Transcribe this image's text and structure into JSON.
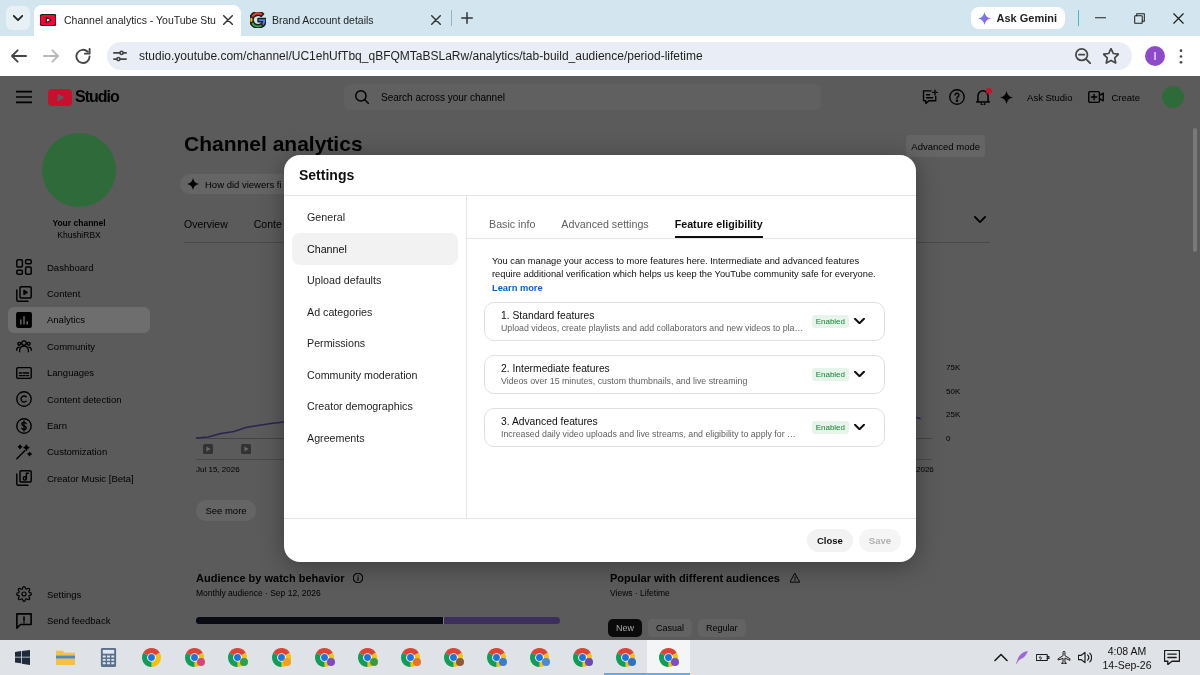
{
  "browser": {
    "tabs": [
      {
        "kind": "youtube",
        "title": "Channel analytics - YouTube Stu",
        "selected": true
      },
      {
        "kind": "google",
        "title": "Brand Account details",
        "selected": false
      }
    ],
    "gemini_button": "Ask Gemini",
    "forward_disabled": true,
    "url": "studio.youtube.com/channel/UC1ehUfTbq_qBFQMTaBSLaRw/analytics/tab-build_audience/period-lifetime",
    "bookmarked": false,
    "profile_initial": "I"
  },
  "studio": {
    "logo": "Studio",
    "search": {
      "placeholder": "Search across your channel"
    },
    "unread_notifications": true,
    "ask_button": "Ask Studio",
    "create_button": "Create",
    "channel": {
      "caption": "Your channel",
      "name": "KhushiRBX"
    },
    "nav": [
      {
        "label": "Dashboard",
        "selected": false
      },
      {
        "label": "Content",
        "selected": false
      },
      {
        "label": "Analytics",
        "selected": true
      },
      {
        "label": "Community",
        "selected": false
      },
      {
        "label": "Languages",
        "selected": false
      },
      {
        "label": "Content detection",
        "selected": false
      },
      {
        "label": "Earn",
        "selected": false
      },
      {
        "label": "Customization",
        "selected": false
      },
      {
        "label": "Creator Music [Beta]",
        "selected": false
      }
    ],
    "footer_nav": [
      "Settings",
      "Send feedback"
    ],
    "page_title": "Channel analytics",
    "advanced_mode": "Advanced mode",
    "prompt_chip": "How did viewers fi",
    "tabs": [
      {
        "label": "Overview",
        "selected": false
      },
      {
        "label": "Conte",
        "selected": false
      }
    ],
    "chart": {
      "x_labels": [
        "Jul 15, 2026",
        "2026"
      ],
      "y_labels": [
        "75K",
        "50K",
        "25K",
        "0"
      ]
    },
    "see_more": "See more",
    "audience": {
      "title": "Audience by watch behavior",
      "subtitle": "Monthly audience · Sep 12, 2026",
      "level": 0.68
    },
    "popular": {
      "title": "Popular with different audiences",
      "subtitle": "Views · Lifetime",
      "chips": [
        {
          "label": "New",
          "selected": true
        },
        {
          "label": "Casual",
          "selected": false
        },
        {
          "label": "Regular",
          "selected": false
        }
      ]
    }
  },
  "dialog": {
    "title": "Settings",
    "nav": [
      {
        "label": "General",
        "selected": false
      },
      {
        "label": "Channel",
        "selected": true
      },
      {
        "label": "Upload defaults",
        "selected": false
      },
      {
        "label": "Ad categories",
        "selected": false
      },
      {
        "label": "Permissions",
        "selected": false
      },
      {
        "label": "Community moderation",
        "selected": false
      },
      {
        "label": "Creator demographics",
        "selected": false
      },
      {
        "label": "Agreements",
        "selected": false
      }
    ],
    "tabs": [
      {
        "label": "Basic info",
        "selected": false
      },
      {
        "label": "Advanced settings",
        "selected": false
      },
      {
        "label": "Feature eligibility",
        "selected": true
      }
    ],
    "intro": "You can manage your access to more features here. Intermediate and advanced features require additional verification which helps us keep the YouTube community safe for everyone.",
    "learn_more": "Learn more",
    "features": [
      {
        "title": "1. Standard features",
        "description": "Upload videos, create playlists and add collaborators and new videos to pla…",
        "status": "Enabled",
        "expanded": false
      },
      {
        "title": "2. Intermediate features",
        "description": "Videos over 15 minutes, custom thumbnails, and live streaming",
        "status": "Enabled",
        "expanded": false
      },
      {
        "title": "3. Advanced features",
        "description": "Increased daily video uploads and live streams, and eligibility to apply for …",
        "status": "Enabled",
        "expanded": false
      }
    ],
    "buttons": [
      {
        "label": "Close",
        "disabled": false
      },
      {
        "label": "Save",
        "disabled": true
      }
    ]
  },
  "taskbar": {
    "apps": [
      {
        "kind": "explorer",
        "open": false,
        "selected": false
      },
      {
        "kind": "calculator",
        "open": false,
        "selected": false
      },
      {
        "kind": "browser",
        "open": false,
        "selected": false
      },
      {
        "kind": "browser",
        "color": "#d6457a",
        "open": false,
        "selected": false
      },
      {
        "kind": "browser",
        "color": "#2e9e4f",
        "open": false,
        "selected": false
      },
      {
        "kind": "browser",
        "color": "#f0a020",
        "open": false,
        "selected": false
      },
      {
        "kind": "browser",
        "color": "#7b4bc4",
        "open": false,
        "selected": false
      },
      {
        "kind": "browser",
        "color": "#3a9a40",
        "open": false,
        "selected": false
      },
      {
        "kind": "browser",
        "color": "#e8742a",
        "open": false,
        "selected": false
      },
      {
        "kind": "browser",
        "color": "#8a5a3c",
        "open": false,
        "selected": false
      },
      {
        "kind": "browser",
        "color": "#3a7bd5",
        "open": false,
        "selected": false
      },
      {
        "kind": "browser",
        "color": "#4a8ad8",
        "open": false,
        "selected": false
      },
      {
        "kind": "browser",
        "color": "#6a48b8",
        "open": false,
        "selected": false
      },
      {
        "kind": "browser",
        "color": "#2f6fd0",
        "open": true,
        "selected": false
      },
      {
        "kind": "browser",
        "color": "#7e4fc0",
        "open": true,
        "selected": true
      }
    ],
    "time": "4:08 AM",
    "date": "14-Sep-26"
  }
}
